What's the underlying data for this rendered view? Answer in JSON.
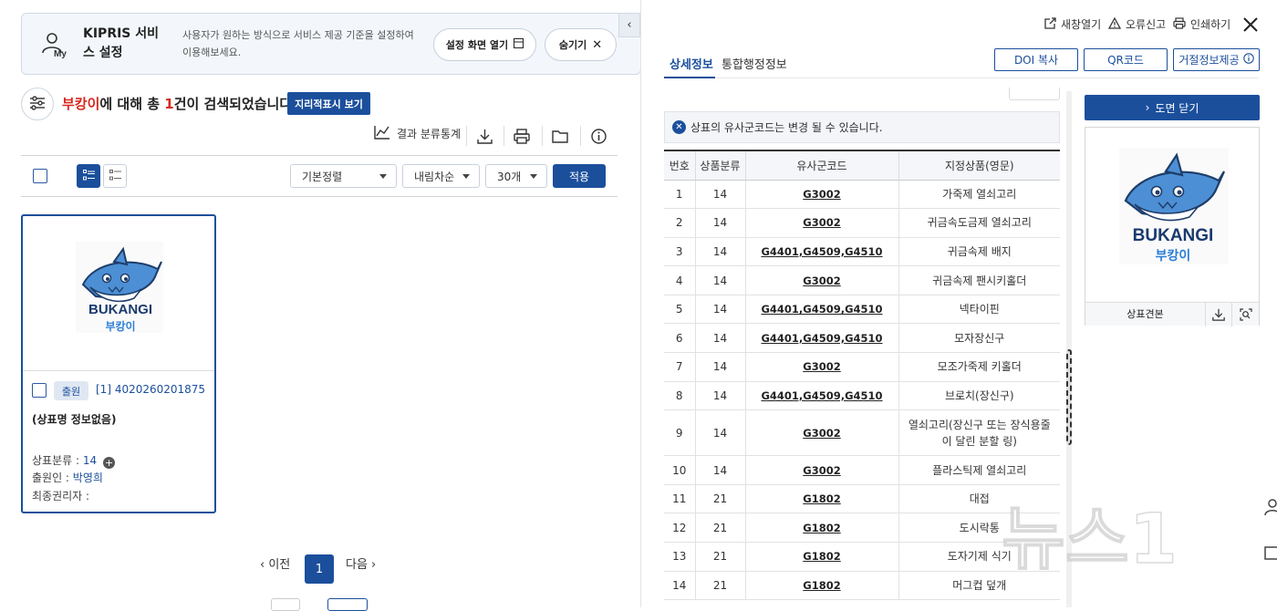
{
  "banner": {
    "title": "KIPRIS 서비스 설정",
    "icon_label": "My",
    "description": "사용자가 원하는 방식으로 서비스 제공 기준을 설정하여 이용해보세요.",
    "open_button": "설정 화면 열기",
    "hide_button": "숨기기"
  },
  "search": {
    "keyword": "부캉이",
    "summary_mid": "에 대해 총 ",
    "count": "1",
    "summary_end": "건이 검색되었습니다.",
    "map_button": "지리적표시 보기",
    "stats_button": "결과 분류통계"
  },
  "controls": {
    "sort": "기본정렬",
    "order": "내림차순",
    "page_size": "30개",
    "apply": "적용"
  },
  "result_card": {
    "status_tag": "출원",
    "index_number": "[1] 4020260201875",
    "name": "(상표명 정보없음)",
    "class_label": "상표분류 : ",
    "class_value": "14",
    "applicant_label": "출원인 : ",
    "applicant_value": "박영희",
    "owner_label": "최종권리자 : ",
    "logo_text": "BUKANGI",
    "logo_sub": "부캉이"
  },
  "pagination": {
    "prev": "이전",
    "current": "1",
    "next": "다음"
  },
  "right_top": {
    "new_window": "새창열기",
    "report_error": "오류신고",
    "print": "인쇄하기"
  },
  "tabs": {
    "detail": "상세정보",
    "admin": "통합행정정보"
  },
  "right_buttons": {
    "doi": "DOI 복사",
    "qr": "QR코드",
    "rejection": "거절정보제공"
  },
  "notice": "상표의 유사군코드는 변경 될 수 있습니다.",
  "goods_table": {
    "headers": [
      "번호",
      "상품분류",
      "유사군코드",
      "지정상품(영문)"
    ],
    "rows": [
      [
        "1",
        "14",
        "G3002",
        "가죽제 열쇠고리"
      ],
      [
        "2",
        "14",
        "G3002",
        "귀금속도금제 열쇠고리"
      ],
      [
        "3",
        "14",
        "G4401,G4509,G4510",
        "귀금속제 배지"
      ],
      [
        "4",
        "14",
        "G3002",
        "귀금속제 팬시키홀더"
      ],
      [
        "5",
        "14",
        "G4401,G4509,G4510",
        "넥타이핀"
      ],
      [
        "6",
        "14",
        "G4401,G4509,G4510",
        "모자장신구"
      ],
      [
        "7",
        "14",
        "G3002",
        "모조가죽제 키홀더"
      ],
      [
        "8",
        "14",
        "G4401,G4509,G4510",
        "브로치(장신구)"
      ],
      [
        "9",
        "14",
        "G3002",
        "열쇠고리(장신구 또는 장식용줄이 달린 분할 링)"
      ],
      [
        "10",
        "14",
        "G3002",
        "플라스틱제 열쇠고리"
      ],
      [
        "11",
        "21",
        "G1802",
        "대접"
      ],
      [
        "12",
        "21",
        "G1802",
        "도시락통"
      ],
      [
        "13",
        "21",
        "G1802",
        "도자기제 식기"
      ],
      [
        "14",
        "21",
        "G1802",
        "머그컵 덮개"
      ]
    ]
  },
  "drawing": {
    "close_button": "도면 닫기",
    "caption": "상표견본"
  },
  "watermark": "뉴스1"
}
